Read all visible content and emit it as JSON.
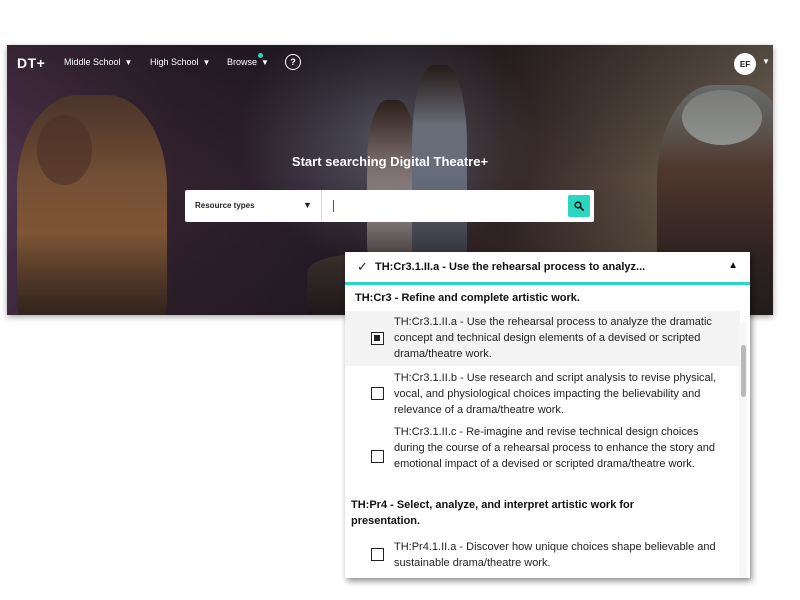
{
  "app": {
    "logo": "DT+",
    "nav": [
      {
        "label": "Middle School"
      },
      {
        "label": "High School"
      },
      {
        "label": "Browse"
      }
    ],
    "help_icon": "?",
    "avatar_initials": "EF"
  },
  "hero": {
    "title": "Start searching Digital Theatre+"
  },
  "search": {
    "resource_types_label": "Resource types",
    "query": "",
    "search_icon": "search-icon"
  },
  "dropdown": {
    "selected_text": "TH:Cr3.1.II.a - Use the rehearsal process to analyz...",
    "groups": [
      {
        "heading": "TH:Cr3 - Refine and complete artistic work.",
        "options": [
          {
            "text": "TH:Cr3.1.II.a - Use the rehearsal process to analyze the dramatic concept and technical design elements of a devised or scripted drama/theatre work.",
            "checked": true
          },
          {
            "text": "TH:Cr3.1.II.b - Use research and script analysis to revise physical, vocal, and physiological choices impacting the believability and relevance of a drama/theatre work.",
            "checked": false
          },
          {
            "text": "TH:Cr3.1.II.c - Re-imagine and revise technical design choices during the course of a rehearsal process to enhance the story and emotional impact of a devised or scripted drama/theatre work.",
            "checked": false
          }
        ]
      },
      {
        "heading": "TH:Pr4 - Select, analyze, and interpret artistic work for presentation.",
        "options": [
          {
            "text": "TH:Pr4.1.II.a - Discover how unique choices shape believable and sustainable drama/theatre work.",
            "checked": false
          }
        ]
      }
    ]
  },
  "colors": {
    "accent": "#2ad6c0",
    "nav_dot": "#2ad6c0",
    "search_button": "#2ad6c0"
  }
}
